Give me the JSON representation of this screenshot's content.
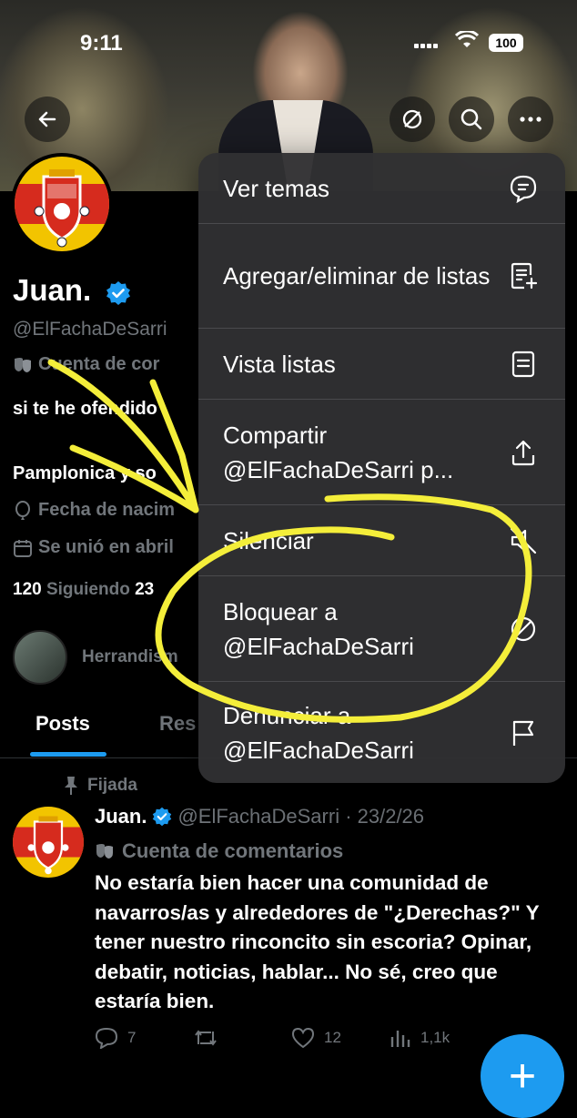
{
  "status_bar": {
    "time": "9:11",
    "battery": "100"
  },
  "profile": {
    "name": "Juan.",
    "handle": "@ElFachaDeSarri",
    "account_label": "Cuenta de cor",
    "bio": "si te he ofendido",
    "location": "Pamplonica y so",
    "birth": "Fecha de nacim",
    "joined": "Se unió en abril",
    "following_count": "120",
    "following_label": "Siguiendo",
    "followers_partial": "23",
    "followed_by": "Herrandism"
  },
  "tabs": {
    "posts": "Posts",
    "replies": "Res"
  },
  "menu": {
    "items": [
      {
        "label": "Ver temas",
        "icon": "topics-icon"
      },
      {
        "label": "Agregar/eliminar de listas",
        "icon": "list-add-icon"
      },
      {
        "label": "Vista listas",
        "icon": "list-icon"
      },
      {
        "label": "Compartir @ElFachaDeSarri p...",
        "icon": "share-icon"
      },
      {
        "label": "Silenciar",
        "icon": "mute-icon"
      },
      {
        "label": "Bloquear a @ElFachaDeSarri",
        "icon": "block-icon"
      },
      {
        "label": "Denunciar a @ElFachaDeSarri",
        "icon": "flag-icon"
      }
    ]
  },
  "pinned_post": {
    "pinned_label": "Fijada",
    "author": "Juan.",
    "handle_date": "@ElFachaDeSarri · 23/2/26",
    "account_type": "Cuenta de comentarios",
    "text": "No estaría bien hacer una comunidad de navarros/as y alrededores de \"¿Derechas?\" Y tener nuestro rinconcito sin escoria? Opinar, debatir, noticias, hablar... No sé, creo que estaría bien.",
    "replies": "7",
    "reposts": "",
    "likes": "12",
    "views": "1,1k"
  },
  "colors": {
    "accent": "#1d9bf0",
    "annotation": "#f4ee3a",
    "menu_bg": "#303032"
  },
  "fab_label": "+"
}
